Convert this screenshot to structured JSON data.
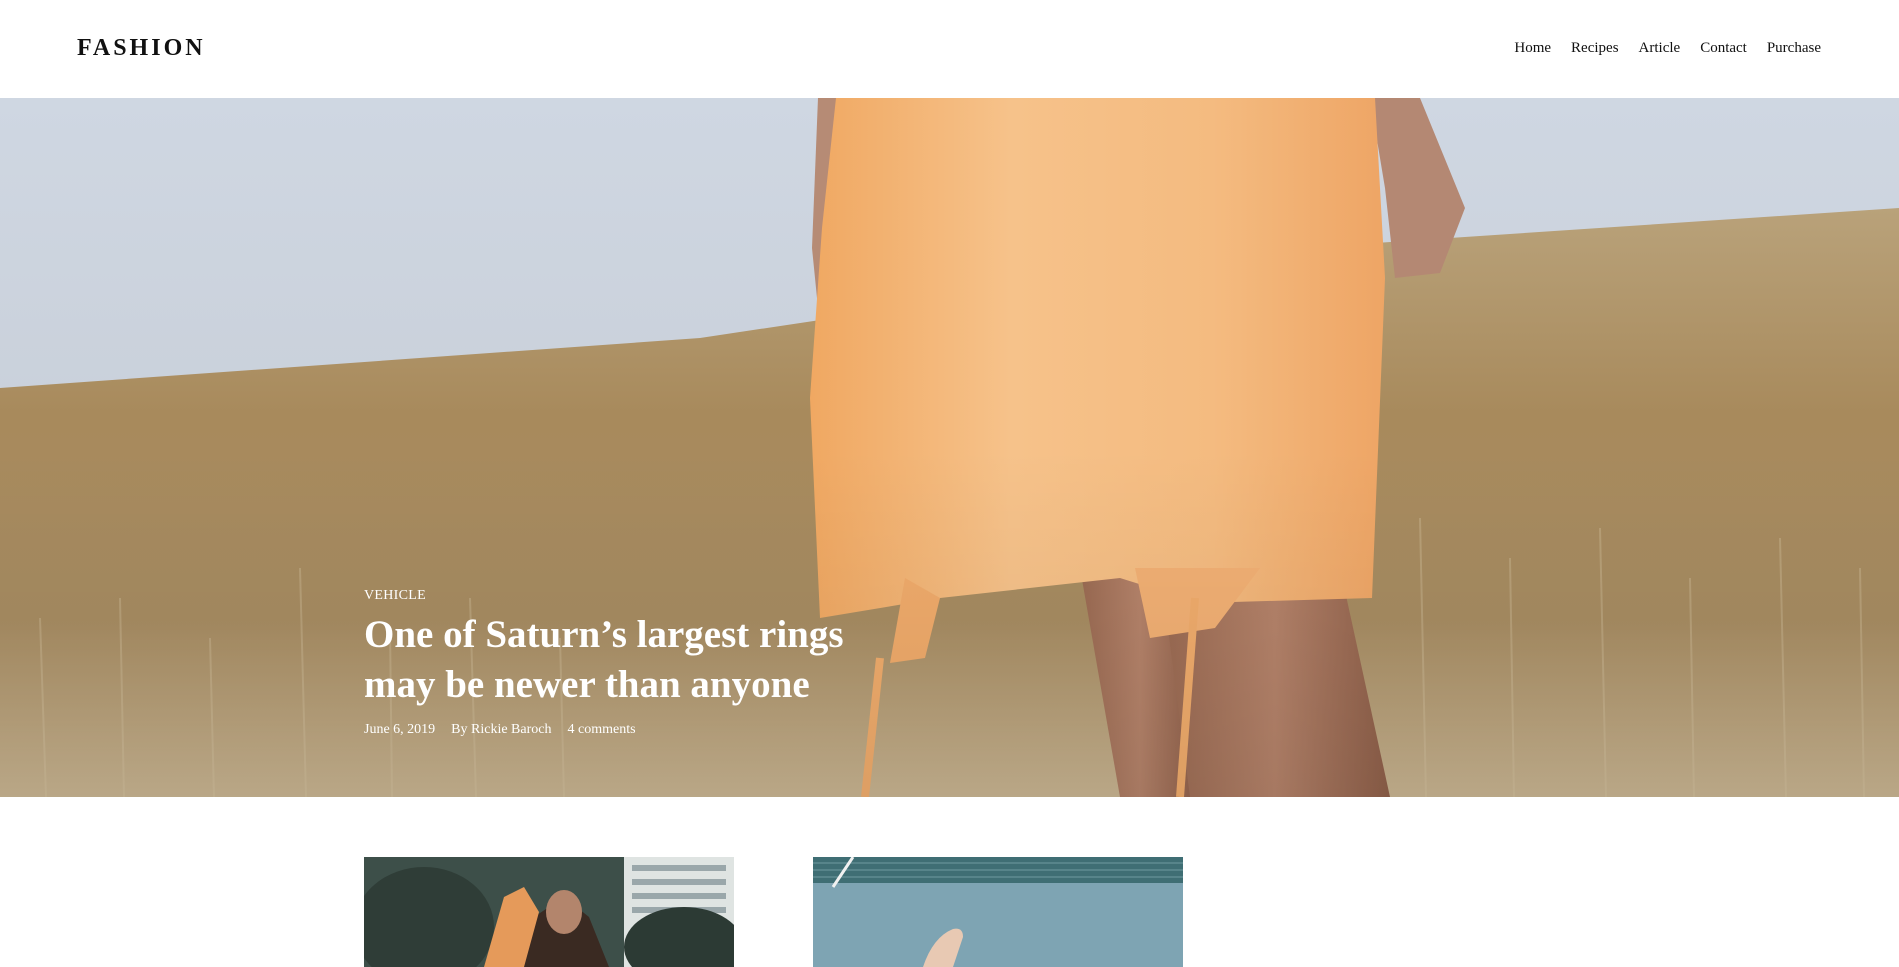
{
  "header": {
    "logo": "FASHION",
    "nav": [
      "Home",
      "Recipes",
      "Article",
      "Contact",
      "Purchase"
    ]
  },
  "hero": {
    "category": "VEHICLE",
    "title": "One of Saturn’s largest rings may be newer than anyone",
    "date": "June 6, 2019",
    "author": "By Rickie Baroch",
    "comments": "4 comments"
  },
  "cards": [
    {
      "image": "woman-portrait-city-photo"
    },
    {
      "image": "poolside-photo"
    }
  ],
  "colors": {
    "text": "#111111",
    "hero_text": "#ffffff",
    "dress": "#f3b677",
    "sky": "#c9d1dc",
    "field": "#a8895c"
  }
}
